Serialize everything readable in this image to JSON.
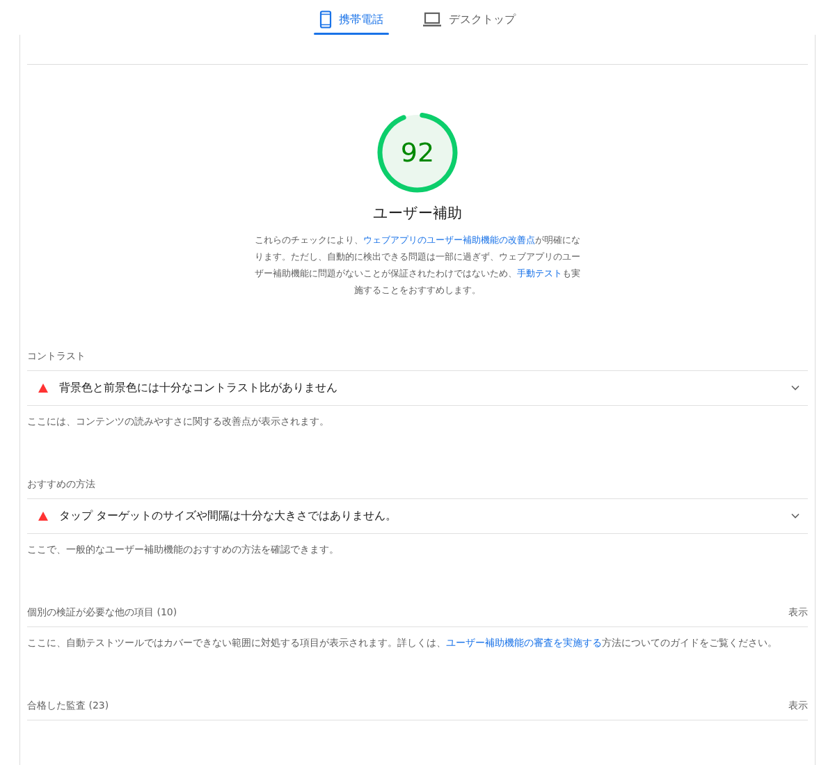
{
  "tabs": [
    {
      "kind": "phone",
      "label": "携帯電話",
      "selected": true
    },
    {
      "kind": "laptop",
      "label": "デスクトップ",
      "selected": false
    }
  ],
  "score": {
    "value": "92",
    "level": 0.92
  },
  "category": {
    "title": "ユーザー補助",
    "description": [
      {
        "kind": "text",
        "text": "これらのチェックにより、"
      },
      {
        "kind": "link",
        "text": "ウェブアプリのユーザー補助機能の改善点"
      },
      {
        "kind": "text",
        "text": "が明確になります。ただし、自動的に検出できる問題は一部に過ぎず、ウェブアプリのユーザー補助機能に問題がないことが保証されたわけではないため、"
      },
      {
        "kind": "link",
        "text": "手動テスト"
      },
      {
        "kind": "text",
        "text": "も実施することをおすすめします。"
      }
    ]
  },
  "groups": [
    {
      "kind": "audits",
      "title": "コントラスト",
      "audits": [
        {
          "kind": "fail",
          "title": "背景色と前景色には十分なコントラスト比がありません",
          "expanded": false
        }
      ],
      "description": [
        {
          "kind": "text",
          "text": "ここには、コンテンツの読みやすさに関する改善点が表示されます。"
        }
      ]
    },
    {
      "kind": "audits",
      "title": "おすすめの方法",
      "audits": [
        {
          "kind": "fail",
          "title": "タップ ターゲットのサイズや間隔は十分な大きさではありません。",
          "expanded": false
        }
      ],
      "description": [
        {
          "kind": "text",
          "text": "ここで、一般的なユーザー補助機能のおすすめの方法を確認できます。"
        }
      ]
    },
    {
      "kind": "collapsed",
      "title": "個別の検証が必要な他の項目",
      "count": "(10)",
      "toggle": "表示",
      "description": [
        {
          "kind": "text",
          "text": "ここに、自動テストツールではカバーできない範囲に対処する項目が表示されます。詳しくは、"
        },
        {
          "kind": "link",
          "text": "ユーザー補助機能の審査を実施する"
        },
        {
          "kind": "text",
          "text": "方法についてのガイドをご覧ください。"
        }
      ]
    },
    {
      "kind": "collapsed",
      "title": "合格した監査",
      "count": "(23)",
      "toggle": "表示"
    }
  ]
}
